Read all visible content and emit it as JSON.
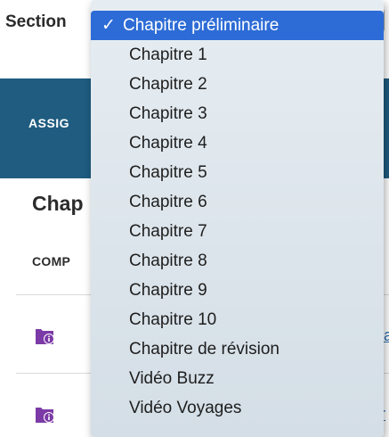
{
  "filter": {
    "label": "Section"
  },
  "banner": {
    "text": "ASSIG"
  },
  "content": {
    "chapter_heading": "Chap",
    "column_header": "COMP",
    "rows": [
      {
        "link_fragment": "sa"
      },
      {
        "link_fragment": "tr"
      }
    ]
  },
  "dropdown": {
    "check_mark": "✓",
    "selected_index": 0,
    "options": [
      "Chapitre préliminaire",
      "Chapitre 1",
      "Chapitre 2",
      "Chapitre 3",
      "Chapitre 4",
      "Chapitre 5",
      "Chapitre 6",
      "Chapitre 7",
      "Chapitre 8",
      "Chapitre 9",
      "Chapitre 10",
      "Chapitre de révision",
      "Vidéo Buzz",
      "Vidéo Voyages"
    ]
  },
  "colors": {
    "banner": "#1f5c80",
    "selected_option": "#2d6cd6",
    "row_icon": "#7b3aa6",
    "link": "#2a6fb0"
  },
  "icons": {
    "row_icon": "document-info-icon"
  }
}
